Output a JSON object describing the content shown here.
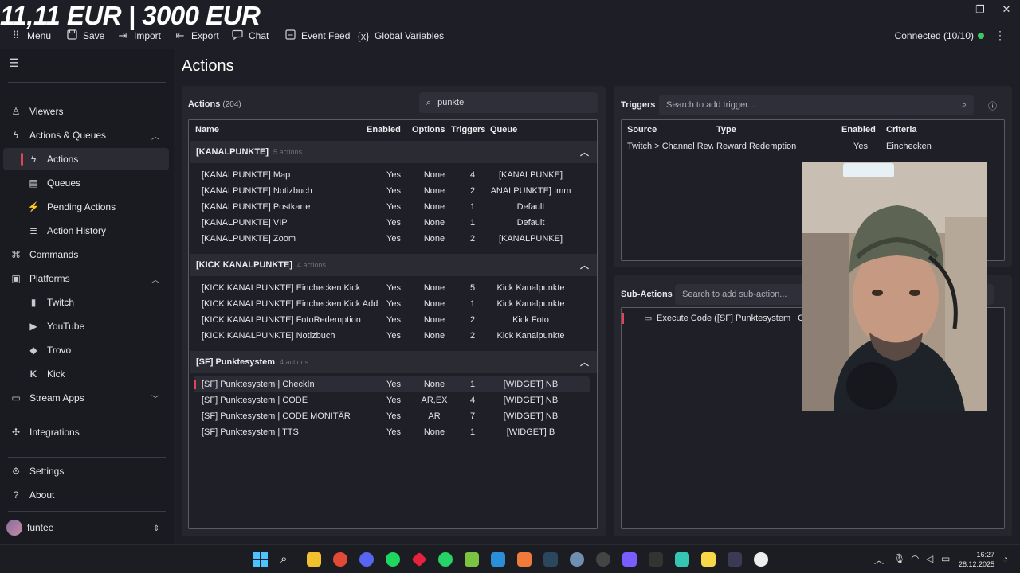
{
  "overlay": {
    "title": "11,11 EUR | 3000 EUR"
  },
  "window": {
    "minimize": "—",
    "maximize": "❐",
    "close": "✕"
  },
  "toolbar": {
    "items": [
      {
        "label": "Menu",
        "icon": "grid-icon"
      },
      {
        "label": "Save",
        "icon": "save-icon"
      },
      {
        "label": "Import",
        "icon": "import-icon"
      },
      {
        "label": "Export",
        "icon": "export-icon"
      },
      {
        "label": "Chat",
        "icon": "chat-icon"
      },
      {
        "label": "Event Feed",
        "icon": "event-feed-icon"
      },
      {
        "label": "Global Variables",
        "icon": "variables-icon"
      }
    ],
    "connected": "Connected (10/10)",
    "status_color": "#3ec95c"
  },
  "sidebar": {
    "items": [
      {
        "label": "Viewers"
      },
      {
        "label": "Actions & Queues"
      },
      {
        "label": "Actions"
      },
      {
        "label": "Queues"
      },
      {
        "label": "Pending Actions"
      },
      {
        "label": "Action History"
      },
      {
        "label": "Commands"
      },
      {
        "label": "Platforms"
      },
      {
        "label": "Twitch"
      },
      {
        "label": "YouTube"
      },
      {
        "label": "Trovo"
      },
      {
        "label": "Kick"
      },
      {
        "label": "Stream Apps"
      },
      {
        "label": "Integrations"
      }
    ],
    "settings": "Settings",
    "about": "About",
    "user": "funtee"
  },
  "page": {
    "title": "Actions"
  },
  "actions": {
    "label": "Actions",
    "count": "(204)",
    "search_value": "punkte",
    "columns": [
      "Name",
      "Enabled",
      "Options",
      "Triggers",
      "Queue"
    ],
    "groups": [
      {
        "name": "[KANALPUNKTE]",
        "count": "5 actions",
        "rows": [
          [
            "[KANALPUNKTE] Map",
            "Yes",
            "None",
            "4",
            "[KANALPUNKE]"
          ],
          [
            "[KANALPUNKTE] Notizbuch",
            "Yes",
            "None",
            "2",
            "ANALPUNKTE] Imm"
          ],
          [
            "[KANALPUNKTE] Postkarte",
            "Yes",
            "None",
            "1",
            "Default"
          ],
          [
            "[KANALPUNKTE] VIP",
            "Yes",
            "None",
            "1",
            "Default"
          ],
          [
            "[KANALPUNKTE] Zoom",
            "Yes",
            "None",
            "2",
            "[KANALPUNKE]"
          ]
        ]
      },
      {
        "name": "[KICK KANALPUNKTE]",
        "count": "4 actions",
        "rows": [
          [
            "[KICK KANALPUNKTE] Einchecken Kick",
            "Yes",
            "None",
            "5",
            "Kick Kanalpunkte"
          ],
          [
            "[KICK KANALPUNKTE] Einchecken Kick Add",
            "Yes",
            "None",
            "1",
            "Kick Kanalpunkte"
          ],
          [
            "[KICK KANALPUNKTE] FotoRedemption",
            "Yes",
            "None",
            "2",
            "Kick Foto"
          ],
          [
            "[KICK KANALPUNKTE] Notizbuch",
            "Yes",
            "None",
            "2",
            "Kick Kanalpunkte"
          ]
        ]
      },
      {
        "name": "[SF] Punktesystem",
        "count": "4 actions",
        "rows": [
          [
            "[SF] Punktesystem | CheckIn",
            "Yes",
            "None",
            "1",
            "[WIDGET] NB"
          ],
          [
            "[SF] Punktesystem | CODE",
            "Yes",
            "AR,EX",
            "4",
            "[WIDGET] NB"
          ],
          [
            "[SF] Punktesystem | CODE MONITÄR",
            "Yes",
            "AR",
            "7",
            "[WIDGET] NB"
          ],
          [
            "[SF] Punktesystem | TTS",
            "Yes",
            "None",
            "1",
            "[WIDGET] B"
          ]
        ]
      }
    ]
  },
  "triggers": {
    "label": "Triggers",
    "placeholder": "Search to add trigger...",
    "columns": [
      "Source",
      "Type",
      "Enabled",
      "Criteria"
    ],
    "rows": [
      [
        "Twitch > Channel Rewa",
        "Reward Redemption",
        "Yes",
        "Einchecken"
      ]
    ]
  },
  "subactions": {
    "label": "Sub-Actions",
    "placeholder": "Search to add sub-action...",
    "items": [
      "Execute Code ([SF] Punktesystem | CheckIn"
    ]
  },
  "taskbar": {
    "time": "16:27",
    "date": "28.12.2025"
  }
}
